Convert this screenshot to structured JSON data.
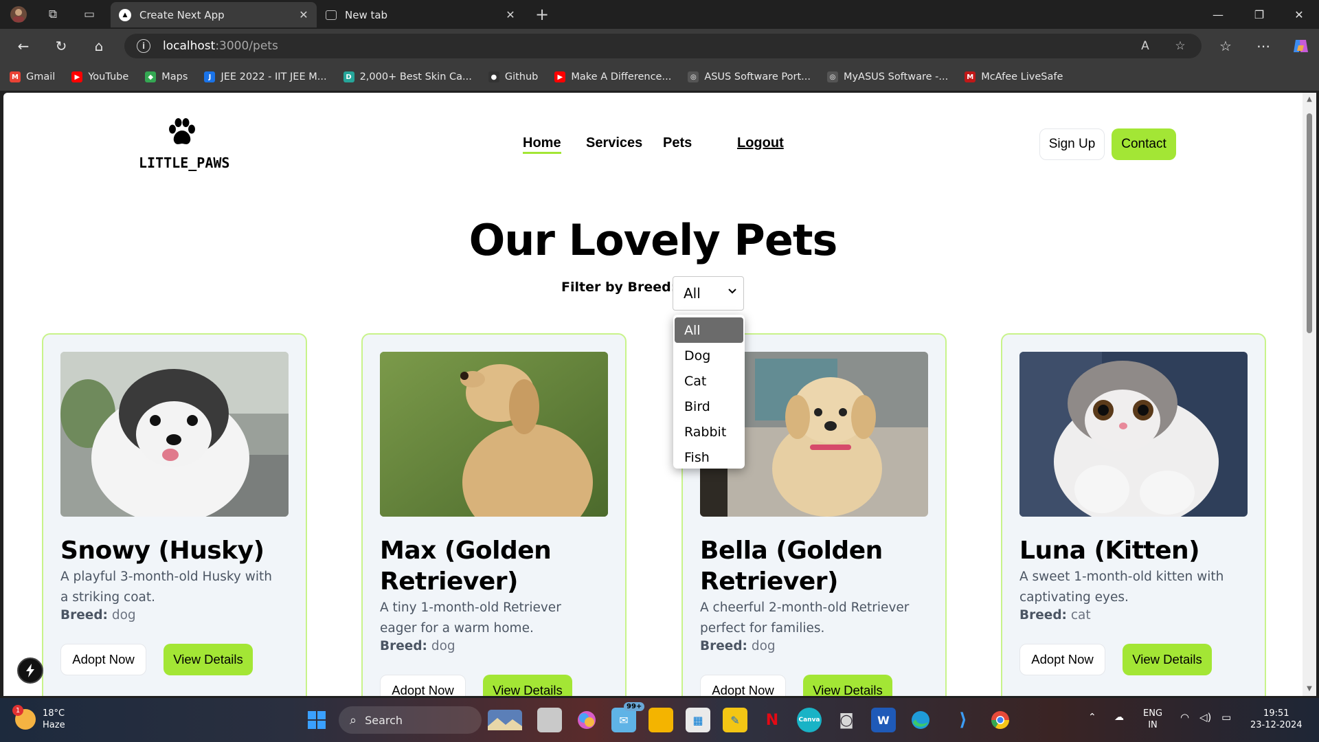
{
  "browser": {
    "tabs": [
      {
        "title": "Create Next App",
        "active": true
      },
      {
        "title": "New tab",
        "active": false
      }
    ],
    "url_host": "localhost",
    "url_path": ":3000/pets",
    "bookmarks": [
      {
        "label": "Gmail",
        "icon": "gmail-icon",
        "color": "#ea4335",
        "glyph": "M"
      },
      {
        "label": "YouTube",
        "icon": "youtube-icon",
        "color": "#ff0000",
        "glyph": "▶"
      },
      {
        "label": "Maps",
        "icon": "maps-icon",
        "color": "#34a853",
        "glyph": "◆"
      },
      {
        "label": "JEE 2022 - IIT JEE M...",
        "icon": "jee-icon",
        "color": "#1a73e8",
        "glyph": "J"
      },
      {
        "label": "2,000+ Best Skin Ca...",
        "icon": "skincare-icon",
        "color": "#26a69a",
        "glyph": "D"
      },
      {
        "label": "Github",
        "icon": "github-icon",
        "color": "#333333",
        "glyph": "●"
      },
      {
        "label": "Make A Difference...",
        "icon": "youtube-icon",
        "color": "#ff0000",
        "glyph": "▶"
      },
      {
        "label": "ASUS Software Port...",
        "icon": "globe-icon",
        "color": "#555555",
        "glyph": "◎"
      },
      {
        "label": "MyASUS Software -...",
        "icon": "globe-icon",
        "color": "#555555",
        "glyph": "◎"
      },
      {
        "label": "McAfee LiveSafe",
        "icon": "mcafee-icon",
        "color": "#c01818",
        "glyph": "M"
      }
    ]
  },
  "site": {
    "logo_text": "LITTLE_PAWS",
    "nav": {
      "home": "Home",
      "services": "Services",
      "pets": "Pets",
      "logout": "Logout"
    },
    "signup": "Sign Up",
    "contact": "Contact"
  },
  "page": {
    "title": "Our Lovely Pets",
    "filter_label": "Filter by Breed:",
    "filter_value": "All",
    "filter_options": [
      "All",
      "Dog",
      "Cat",
      "Bird",
      "Rabbit",
      "Fish"
    ]
  },
  "pets": [
    {
      "name": "Snowy (Husky)",
      "description": "A playful 3-month-old Husky with a striking coat.",
      "breed_label": "Breed:",
      "breed": "dog",
      "adopt": "Adopt Now",
      "details": "View Details"
    },
    {
      "name": "Max (Golden Retriever)",
      "description": "A tiny 1-month-old Retriever eager for a warm home.",
      "breed_label": "Breed:",
      "breed": "dog",
      "adopt": "Adopt Now",
      "details": "View Details"
    },
    {
      "name": "Bella (Golden Retriever)",
      "description": "A cheerful 2-month-old Retriever perfect for families.",
      "breed_label": "Breed:",
      "breed": "dog",
      "adopt": "Adopt Now",
      "details": "View Details"
    },
    {
      "name": "Luna (Kitten)",
      "description": "A sweet 1-month-old kitten with captivating eyes.",
      "breed_label": "Breed:",
      "breed": "cat",
      "adopt": "Adopt Now",
      "details": "View Details"
    }
  ],
  "taskbar": {
    "weather_temp": "18°C",
    "weather_desc": "Haze",
    "notification_count": "1",
    "search": "Search",
    "mail_badge": "99+",
    "lang_top": "ENG",
    "lang_bottom": "IN",
    "time": "19:51",
    "date": "23-12-2024"
  },
  "colors": {
    "accent": "#a3e635",
    "card_bg": "#f1f5f9",
    "card_border": "#c8f38a"
  }
}
